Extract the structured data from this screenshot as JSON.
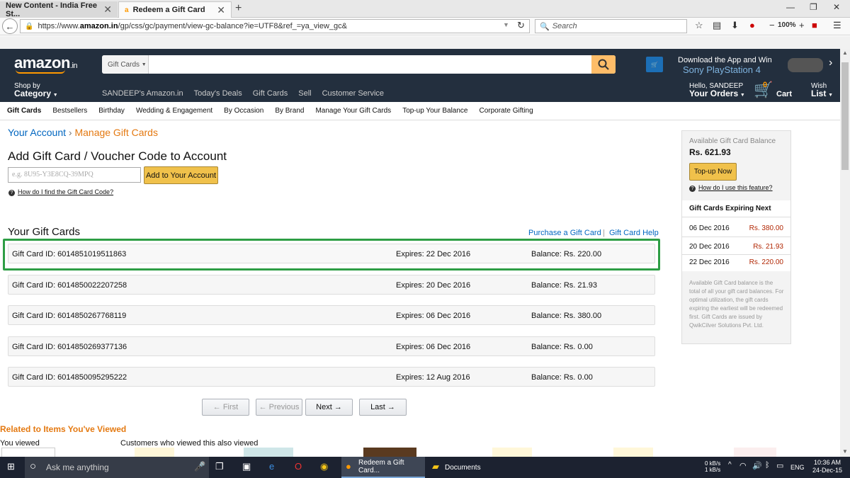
{
  "browser": {
    "tabs": [
      {
        "title": "New Content - India Free St..."
      },
      {
        "title": "Redeem a Gift Card"
      }
    ],
    "url_prefix": "https://www.",
    "url_domain": "amazon.in",
    "url_rest": "/gp/css/gc/payment/view-gc-balance?ie=UTF8&ref_=ya_view_gc&",
    "search_placeholder": "Search",
    "zoom": "100%"
  },
  "header": {
    "logo": "amazon",
    "logo_suffix": ".in",
    "search_category": "Gift Cards",
    "promo_line1": "Download the App and Win",
    "promo_line2": "Sony PlayStation 4",
    "shop_by": "Shop by",
    "category": "Category",
    "nav_links": [
      "SANDEEP's Amazon.in",
      "Today's Deals",
      "Gift Cards",
      "Sell",
      "Customer Service"
    ],
    "hello": "Hello, SANDEEP",
    "your_orders": "Your Orders",
    "cart_count": "0",
    "cart": "Cart",
    "wish": "Wish",
    "list": "List"
  },
  "subnav": [
    "Gift Cards",
    "Bestsellers",
    "Birthday",
    "Wedding & Engagement",
    "By Occasion",
    "By Brand",
    "Manage Your Gift Cards",
    "Top-up Your Balance",
    "Corporate Gifting"
  ],
  "breadcrumb": {
    "account": "Your Account",
    "separator": "›",
    "manage": "Manage Gift Cards"
  },
  "add_section": {
    "title": "Add Gift Card / Voucher Code to Account",
    "placeholder": "e.g. 8U95-Y3E8CQ-39MPQ",
    "button": "Add to Your Account",
    "help": "How do I find the Gift Card Code?"
  },
  "cards_section": {
    "title": "Your Gift Cards",
    "purchase": "Purchase a Gift Card",
    "separator": "|",
    "help": "Gift Card Help",
    "cards": [
      {
        "id": "Gift Card ID: 6014851019511863",
        "expires": "Expires: 22 Dec 2016",
        "balance": "Balance: Rs. 220.00"
      },
      {
        "id": "Gift Card ID: 6014850022207258",
        "expires": "Expires: 20 Dec 2016",
        "balance": "Balance: Rs. 21.93"
      },
      {
        "id": "Gift Card ID: 6014850267768119",
        "expires": "Expires: 06 Dec 2016",
        "balance": "Balance: Rs. 380.00"
      },
      {
        "id": "Gift Card ID: 6014850269377136",
        "expires": "Expires: 06 Dec 2016",
        "balance": "Balance: Rs. 0.00"
      },
      {
        "id": "Gift Card ID: 6014850095295222",
        "expires": "Expires: 12 Aug 2016",
        "balance": "Balance: Rs. 0.00"
      }
    ]
  },
  "pagination": {
    "first": "← First",
    "previous": "← Previous",
    "next": "Next →",
    "last": "Last →"
  },
  "related": {
    "title": "Related to Items You've Viewed",
    "you_viewed": "You viewed",
    "customers": "Customers who viewed this also viewed"
  },
  "right_panel": {
    "available_title": "Available Gift Card Balance",
    "balance": "Rs. 621.93",
    "topup": "Top-up Now",
    "help": "How do I use this feature?",
    "expiring_title": "Gift Cards Expiring Next",
    "expiring": [
      {
        "date": "06 Dec 2016",
        "amount": "Rs. 380.00"
      },
      {
        "date": "20 Dec 2016",
        "amount": "Rs. 21.93"
      },
      {
        "date": "22 Dec 2016",
        "amount": "Rs. 220.00"
      }
    ],
    "note": "Available Gift Card balance is the total of all your gift card balances. For optimal utilization, the gift cards expiring the earliest will be redeemed first. Gift Cards are issued by QwikCilver Solutions Pvt. Ltd."
  },
  "taskbar": {
    "search": "Ask me anything",
    "app1": "Redeem a Gift Card...",
    "app2": "Documents",
    "net_up": "0 kB/s",
    "net_down": "1 kB/s",
    "lang": "ENG",
    "time": "10:36 AM",
    "date": "24-Dec-15"
  },
  "colors": {
    "amazon_nav": "#232f3e",
    "accent_orange": "#e47911",
    "highlight_green": "#2e9e45",
    "button_yellow": "#f0c14b"
  }
}
